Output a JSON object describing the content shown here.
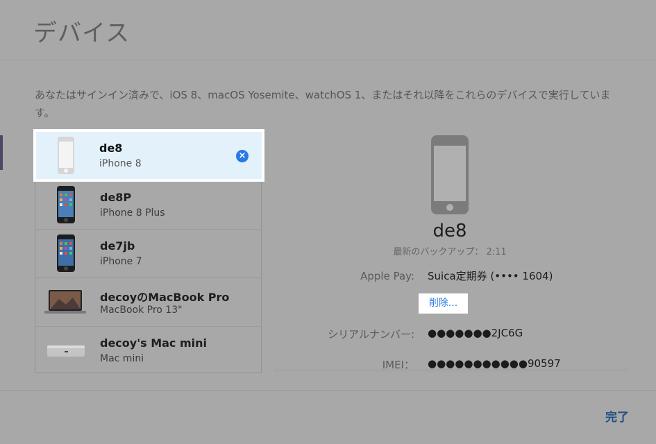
{
  "title": "デバイス",
  "intro_text": "あなたはサインイン済みで、iOS 8、macOS Yosemite、watchOS 1、またはそれ以降をこれらのデバイスで実行しています。",
  "devices": [
    {
      "name": "de8",
      "model": "iPhone 8",
      "icon": "iphone-outline-icon",
      "selected": true
    },
    {
      "name": "de8P",
      "model": "iPhone 8 Plus",
      "icon": "iphone-icon"
    },
    {
      "name": "de7jb",
      "model": "iPhone 7",
      "icon": "iphone-icon"
    },
    {
      "name": "decoyのMacBook Pro",
      "model": "MacBook Pro 13\"",
      "icon": "macbook-icon"
    },
    {
      "name": "decoy's Mac mini",
      "model": "Mac mini",
      "icon": "mac-mini-icon"
    }
  ],
  "detail": {
    "name": "de8",
    "backup": "最新のバックアップ： 2:11",
    "apple_pay_label": "Apple Pay:",
    "apple_pay_value": "Suica定期券 (•••• 1604)",
    "delete_label": "削除...",
    "serial_label": "シリアルナンバー:",
    "serial_value": "●●●●●●●2JC6G",
    "imei_label": "IMEI：",
    "imei_value": "●●●●●●●●●●●90597"
  },
  "done_label": "完了",
  "colors": {
    "accent": "#2878e6",
    "selected_bg": "#e3f1fb",
    "done": "#224e85"
  }
}
